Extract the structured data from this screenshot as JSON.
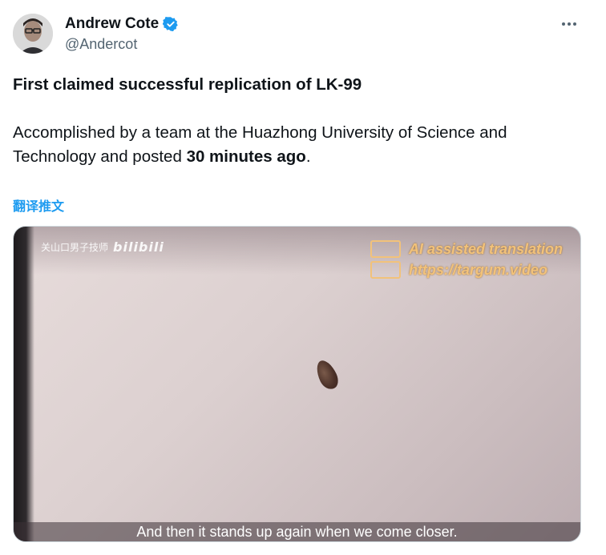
{
  "author": {
    "name": "Andrew Cote",
    "handle": "@Andercot",
    "verified": true,
    "verified_color": "#1d9bf0"
  },
  "tweet": {
    "line1": "First claimed successful replication of LK-99",
    "line2_pre": "Accomplished by a team at the Huazhong University of Science and Technology and posted ",
    "line2_bold": "30 minutes ago",
    "line2_post": "."
  },
  "translate_link": "翻译推文",
  "media": {
    "watermark_text": "关山口男子技师",
    "watermark_brand": "bilibili",
    "overlay_line1": "AI assisted translation",
    "overlay_line2": "https://targum.video",
    "subtitle": "And then it stands up again when we come closer."
  },
  "icons": {
    "more": "more-horizontal-icon",
    "verified": "verified-badge-icon"
  },
  "colors": {
    "text_primary": "#0f1419",
    "text_secondary": "#536471",
    "link": "#1d9bf0"
  }
}
